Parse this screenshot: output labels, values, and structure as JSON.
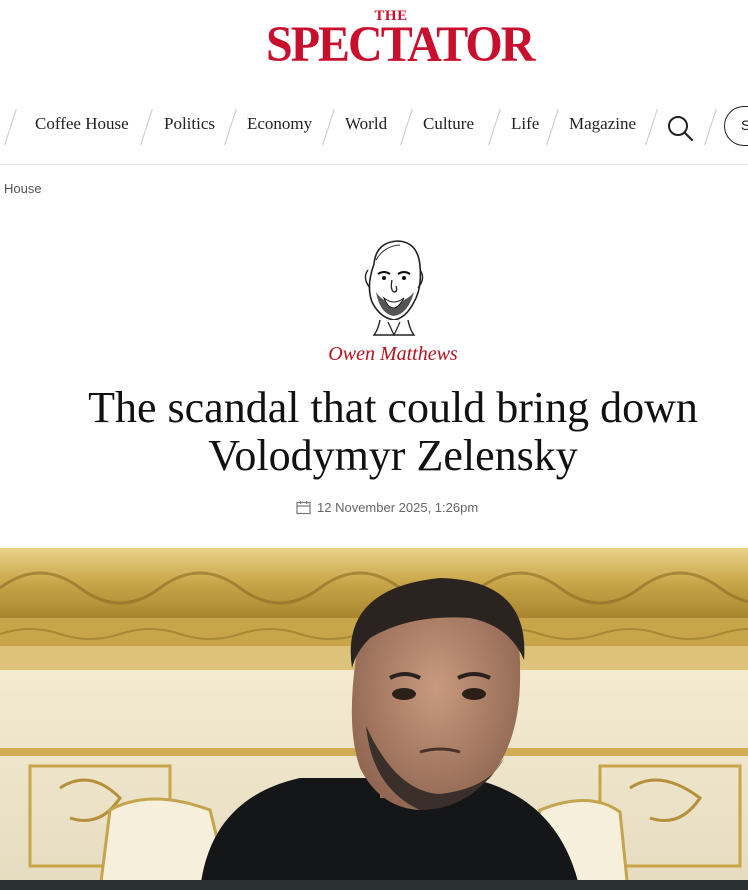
{
  "brand": {
    "the": "THE",
    "name": "SPECTATOR",
    "color": "#c8102e"
  },
  "nav": {
    "items": [
      "Coffee House",
      "Politics",
      "Economy",
      "World",
      "Culture",
      "Life",
      "Magazine"
    ],
    "search_icon": "search-icon",
    "subscribe_partial": "S"
  },
  "breadcrumb": {
    "label": "House"
  },
  "article": {
    "author": "Owen Matthews",
    "title_line1": "The scandal that could bring down",
    "title_line2": "Volodymyr Zelensky",
    "date": "12 November 2025, 1:26pm",
    "date_icon": "calendar-icon"
  },
  "colors": {
    "accent": "#b3121f",
    "gold": "#d4b35a"
  }
}
